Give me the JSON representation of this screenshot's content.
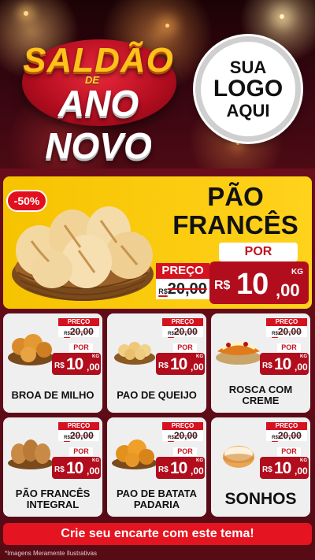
{
  "header": {
    "title_line1": "SALDÃO",
    "title_connector": "DE",
    "title_line2": "ANO NOVO",
    "logo_line1": "SUA",
    "logo_line2": "LOGO",
    "logo_line3": "AQUI"
  },
  "featured": {
    "discount_badge": "-50%",
    "name_line1": "PÃO",
    "name_line2": "FRANCÊS",
    "por_label": "POR",
    "preco_label": "PREÇO",
    "old_currency": "R$",
    "old_price": "20,00",
    "new_currency": "R$",
    "new_int": "10",
    "new_cents": ",00",
    "unit": "KG",
    "image_icon": "bread-basket-icon"
  },
  "products": [
    {
      "name": "BROA DE MILHO",
      "preco_label": "PREÇO",
      "old_currency": "R$",
      "old_price": "20,00",
      "por_label": "POR",
      "currency": "R$",
      "int": "10",
      "cents": ",00",
      "unit": "KG",
      "icon": "corn-bread-icon"
    },
    {
      "name": "PAO DE QUEIJO",
      "preco_label": "PREÇO",
      "old_currency": "R$",
      "old_price": "20,00",
      "por_label": "POR",
      "currency": "R$",
      "int": "10",
      "cents": ",00",
      "unit": "KG",
      "icon": "cheese-bread-icon"
    },
    {
      "name": "ROSCA COM CREME",
      "preco_label": "PREÇO",
      "old_currency": "R$",
      "old_price": "20,00",
      "por_label": "POR",
      "currency": "R$",
      "int": "10",
      "cents": ",00",
      "unit": "KG",
      "icon": "cream-roll-icon"
    },
    {
      "name": "PÃO FRANCÊS INTEGRAL",
      "preco_label": "PREÇO",
      "old_currency": "R$",
      "old_price": "20,00",
      "por_label": "POR",
      "currency": "R$",
      "int": "10",
      "cents": ",00",
      "unit": "KG",
      "icon": "wholegrain-bread-icon"
    },
    {
      "name": "PAO DE BATATA PADARIA",
      "preco_label": "PREÇO",
      "old_currency": "R$",
      "old_price": "20,00",
      "por_label": "POR",
      "currency": "R$",
      "int": "10",
      "cents": ",00",
      "unit": "KG",
      "icon": "potato-bread-icon"
    },
    {
      "name": "SONHOS",
      "preco_label": "PREÇO",
      "old_currency": "R$",
      "old_price": "20,00",
      "por_label": "POR",
      "currency": "R$",
      "int": "10",
      "cents": ",00",
      "unit": "KG",
      "icon": "donut-icon"
    }
  ],
  "footer": {
    "cta_label": "Crie seu encarte com este tema!",
    "disclaimer": "*Imagens Meramente Ilustrativas"
  },
  "colors": {
    "background": "#5a0c16",
    "feature_bg": "#f6c300",
    "price_red": "#b10d1d",
    "cta_red": "#e41420",
    "title_gold": "#ffc21a"
  }
}
